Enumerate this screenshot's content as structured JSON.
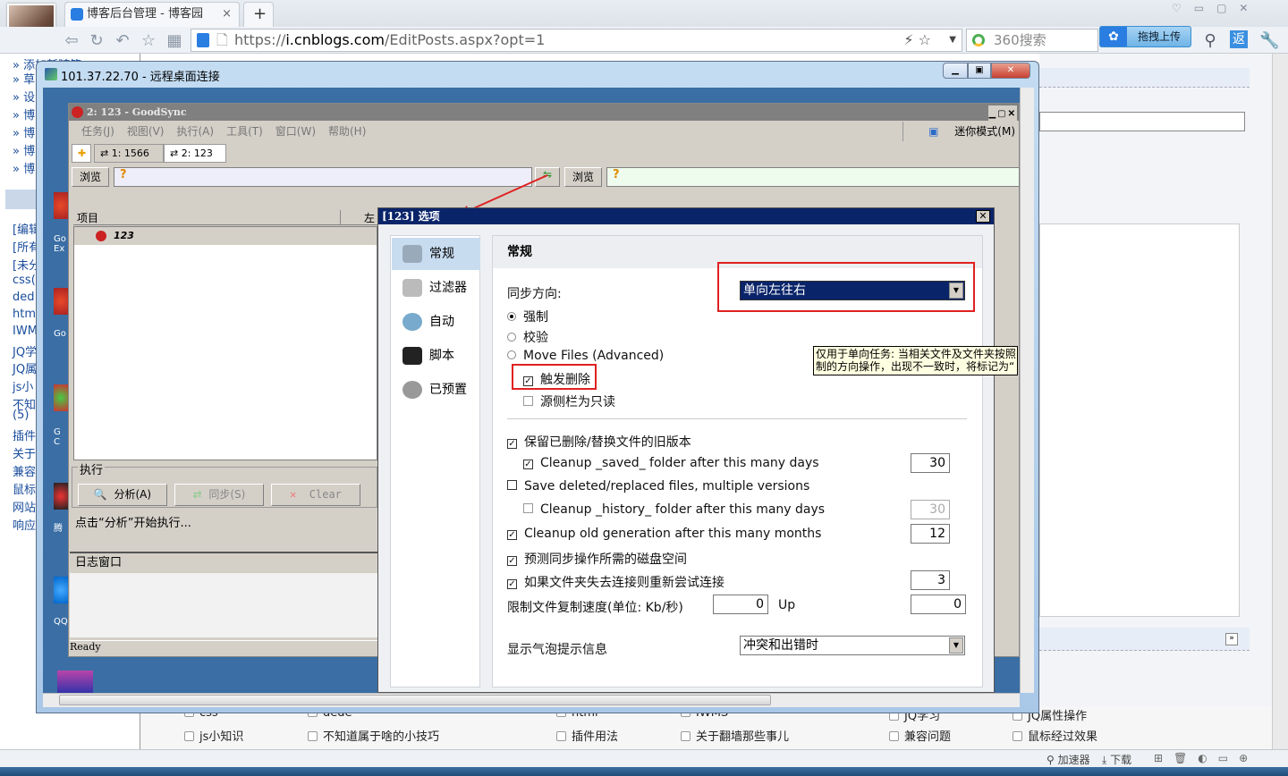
{
  "browser": {
    "tab_title": "博客后台管理 - 博客园",
    "new_tab": "+",
    "url_prefix": "https://",
    "url_host": "i.cnblogs.com",
    "url_path": "/EditPosts.aspx?opt=1",
    "search_placeholder": "360搜索",
    "upload_label": "拖拽上传",
    "return_label": "返",
    "status_items": [
      "加速器",
      "下载"
    ]
  },
  "page": {
    "sidebar_links": [
      "» 添加新随笔",
      "» 草",
      "» 设",
      "» 博",
      "» 博",
      "» 博",
      "» 博"
    ],
    "categories": [
      "[编辑",
      "[所有",
      "[未分",
      "css(",
      "ded",
      "htm",
      "IWM",
      "JQ学",
      "JQ属",
      "js小",
      "不知",
      "(5)",
      "插件",
      "关于",
      "兼容",
      "鼠标",
      "网站",
      "响应"
    ],
    "bottom_row1": [
      "css",
      "dede",
      "html",
      "IWMS",
      "JQ学习",
      "JQ属性操作"
    ],
    "bottom_row2": [
      "js小知识",
      "不知道属于啥的小技巧",
      "插件用法",
      "关于翻墙那些事儿",
      "兼容问题",
      "鼠标经过效果"
    ]
  },
  "rdp": {
    "title": "101.37.22.70 - 远程桌面连接",
    "desktop_icons": [
      "Go Ex",
      "Go",
      "G C",
      "腾",
      "QQ"
    ]
  },
  "goodsync": {
    "title": "2: 123 - GoodSync",
    "menu": [
      "任务(J)",
      "视图(V)",
      "执行(A)",
      "工具(T)",
      "窗口(W)",
      "帮助(H)"
    ],
    "mini_mode": "迷你模式(M)",
    "tabs": [
      "1: 1566",
      "2: 123"
    ],
    "browse": "浏览",
    "path_placeholder": "?",
    "column_item": "项目",
    "column_left": "左",
    "job_name": "123",
    "exec_group": "执行",
    "analyze_btn": "分析(A)",
    "sync_btn": "同步(S)",
    "clear_btn": "Clear",
    "hint": "点击“分析”开始执行...",
    "log_title": "日志窗口",
    "status": "Ready"
  },
  "dialog": {
    "title": "[123] 选项",
    "nav": [
      "常规",
      "过滤器",
      "自动",
      "脚本",
      "已预置"
    ],
    "selected_nav": 0,
    "section": "常规",
    "sync_direction_label": "同步方向:",
    "sync_direction_value": "单向左往右",
    "modes": [
      {
        "label": "强制",
        "selected": true
      },
      {
        "label": "校验",
        "selected": false
      },
      {
        "label": "Move Files (Advanced)",
        "selected": false
      }
    ],
    "propagate_delete": {
      "label": "触发删除",
      "checked": true
    },
    "source_readonly": {
      "label": "源侧栏为只读",
      "checked": false
    },
    "keep_old": {
      "label": "保留已删除/替换文件的旧版本",
      "checked": true
    },
    "cleanup_saved": {
      "label": "Cleanup _saved_ folder after this many days",
      "checked": true,
      "value": "30"
    },
    "save_multiple": {
      "label": "Save deleted/replaced files, multiple versions",
      "checked": false
    },
    "cleanup_history": {
      "label": "Cleanup _history_ folder after this many days",
      "checked": false,
      "value": "30"
    },
    "cleanup_old_gen": {
      "label": "Cleanup old generation after this many months",
      "checked": true,
      "value": "12"
    },
    "predict_space": {
      "label": "预测同步操作所需的磁盘空间",
      "checked": true
    },
    "reconnect": {
      "label": "如果文件夹失去连接则重新尝试连接",
      "checked": true,
      "value": "3"
    },
    "speed_label": "限制文件复制速度(单位: Kb/秒)",
    "speed_down": "0",
    "speed_up_label": "Up",
    "speed_up": "0",
    "balloon_label": "显示气泡提示信息",
    "balloon_value": "冲突和出错时",
    "tooltip_line1": "仅用于单向任务: 当相关文件及文件夹按照",
    "tooltip_line2": "制的方向操作，出现不一致时，将标记为“"
  },
  "colors": {
    "dialog_title": "#0a246a",
    "highlight": "#e02020",
    "desktop": "#3a6ea5"
  }
}
